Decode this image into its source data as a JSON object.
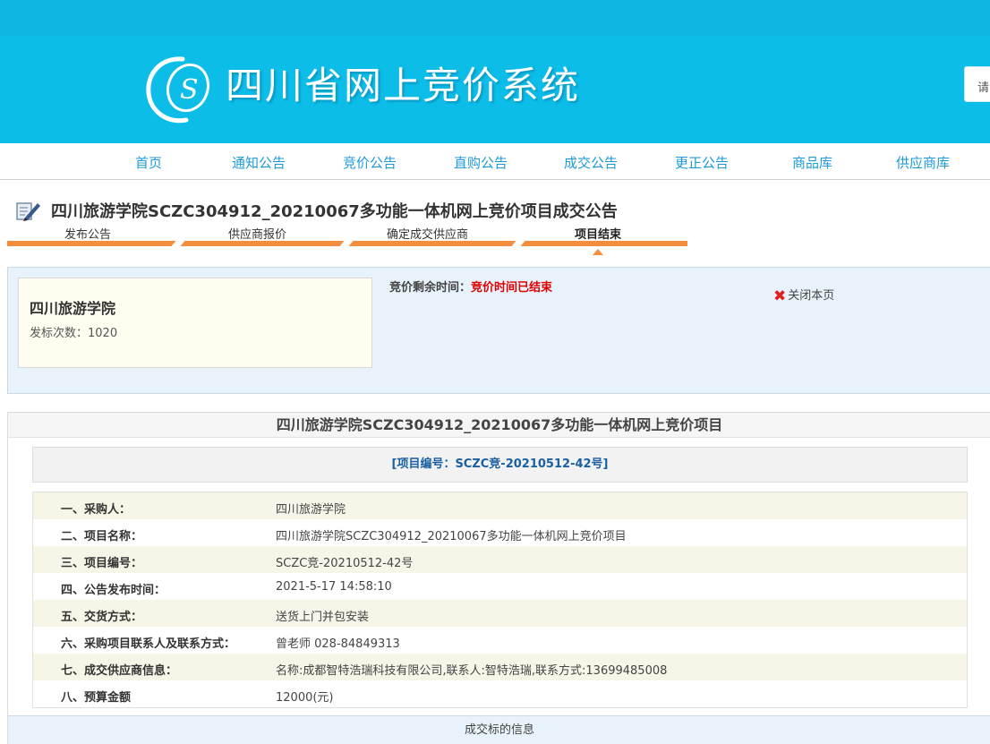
{
  "header": {
    "site_title": "四川省网上竞价系统",
    "search_placeholder": "请"
  },
  "nav": [
    "首页",
    "通知公告",
    "竞价公告",
    "直购公告",
    "成交公告",
    "更正公告",
    "商品库",
    "供应商库"
  ],
  "page": {
    "title": "四川旅游学院SCZC304912_20210067多功能一体机网上竞价项目成交公告",
    "steps": [
      "发布公告",
      "供应商报价",
      "确定成交供应商",
      "项目结束"
    ],
    "active_step": 3
  },
  "info": {
    "org_name": "四川旅游学院",
    "count_label": "发标次数：1020",
    "countdown_label": "竞价剩余时间：",
    "countdown_value": "竞价时间已结束",
    "close_label": "关闭本页"
  },
  "project": {
    "heading": "四川旅游学院SCZC304912_20210067多功能一体机网上竞价项目",
    "number_label": "[项目编号：SCZC竞-20210512-42号]",
    "rows": [
      {
        "k": "一、采购人：",
        "v": "四川旅游学院"
      },
      {
        "k": "二、项目名称：",
        "v": "四川旅游学院SCZC304912_20210067多功能一体机网上竞价项目"
      },
      {
        "k": "三、项目编号：",
        "v": "SCZC竞-20210512-42号"
      },
      {
        "k": "四、公告发布时间：",
        "v": "2021-5-17 14:58:10"
      },
      {
        "k": "五、交货方式：",
        "v": "送货上门并包安装"
      },
      {
        "k": "六、采购项目联系人及联系方式：",
        "v": "曾老师    028-84849313"
      },
      {
        "k": "七、成交供应商信息：",
        "v": "名称:成都智特浩瑞科技有限公司,联系人:智特浩瑞,联系方式:13699485008"
      },
      {
        "k": "八、预算金额",
        "v": "12000(元)"
      }
    ],
    "deal_info_label": "成交标的信息"
  },
  "colors": {
    "header_bg": "#0cbde8",
    "nav_link": "#1e9ad6",
    "step_bar": "#f58d3f",
    "alert_red": "#e00000",
    "project_no": "#1a5fa0"
  },
  "icons": [
    "logo-mark",
    "document-pen-icon",
    "close-x-icon",
    "step-marker"
  ]
}
